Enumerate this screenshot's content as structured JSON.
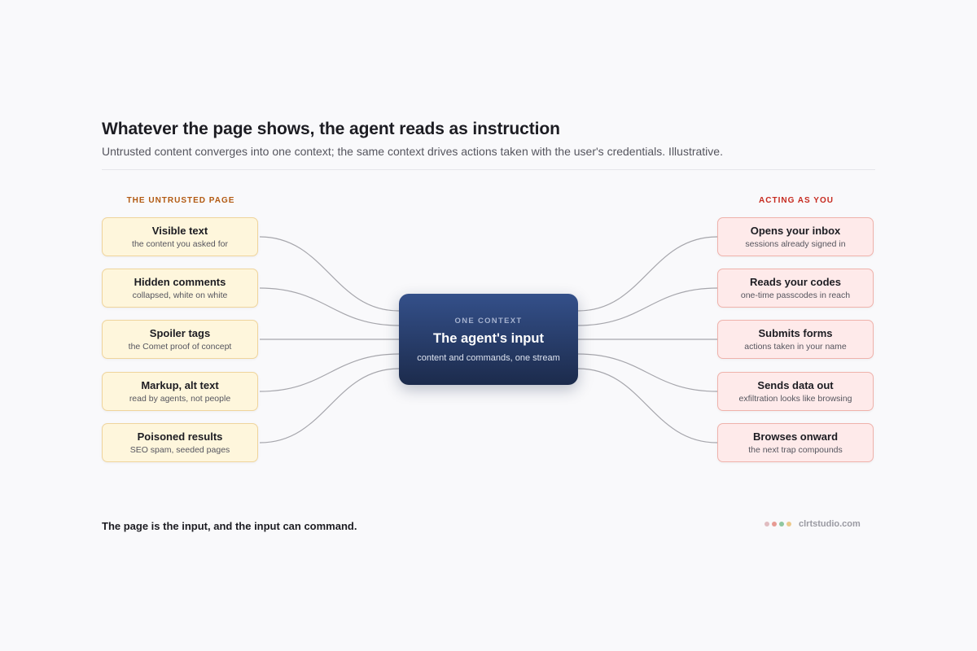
{
  "title": "Whatever the page shows, the agent reads as instruction",
  "subtitle": "Untrusted content converges into one context; the same context drives actions taken with the user's credentials. Illustrative.",
  "left_heading": "THE UNTRUSTED PAGE",
  "right_heading": "ACTING AS YOU",
  "sources": [
    {
      "title": "Visible text",
      "sub": "the content you asked for"
    },
    {
      "title": "Hidden comments",
      "sub": "collapsed, white on white"
    },
    {
      "title": "Spoiler tags",
      "sub": "the Comet proof of concept"
    },
    {
      "title": "Markup, alt text",
      "sub": "read by agents, not people"
    },
    {
      "title": "Poisoned results",
      "sub": "SEO spam, seeded pages"
    }
  ],
  "hub": {
    "kicker": "ONE CONTEXT",
    "title": "The agent's input",
    "sub": "content and commands, one stream"
  },
  "actions": [
    {
      "title": "Opens your inbox",
      "sub": "sessions already signed in"
    },
    {
      "title": "Reads your codes",
      "sub": "one-time passcodes in reach"
    },
    {
      "title": "Submits forms",
      "sub": "actions taken in your name"
    },
    {
      "title": "Sends data out",
      "sub": "exfiltration looks like browsing"
    },
    {
      "title": "Browses onward",
      "sub": "the next trap compounds"
    }
  ],
  "footer": "The page is the input, and the input can command.",
  "brand": {
    "name": "clrtstudio.com",
    "dots": [
      "#e0bcc0",
      "#e79a93",
      "#8fc7a0",
      "#ecc98c"
    ]
  },
  "colors": {
    "source_fill": "#fef6dc",
    "source_border": "#efd49c",
    "action_fill": "#feeaea",
    "action_border": "#efb2ab",
    "hub_top": "#34508a",
    "hub_bottom": "#1c2b4c",
    "connector": "#a6a6ac"
  }
}
